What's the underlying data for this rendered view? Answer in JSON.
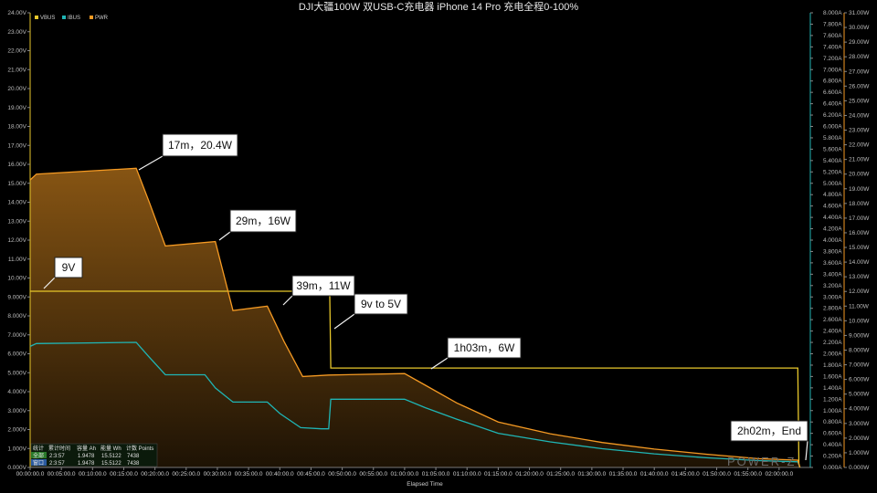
{
  "chart_data": {
    "type": "line",
    "title": "DJI大疆100W 双USB-C充电器 iPhone 14 Pro 充电全程0-100%",
    "xlabel": "Elapsed Time",
    "x_range_seconds": [
      0,
      7500
    ],
    "x_ticks": [
      "00:00:00.0",
      "00:05:00.0",
      "00:10:00.0",
      "00:15:00.0",
      "00:20:00.0",
      "00:25:00.0",
      "00:30:00.0",
      "00:35:00.0",
      "00:40:00.0",
      "00:45:00.0",
      "00:50:00.0",
      "00:55:00.0",
      "01:00:00.0",
      "01:05:00.0",
      "01:10:00.0",
      "01:15:00.0",
      "01:20:00.0",
      "01:25:00.0",
      "01:30:00.0",
      "01:35:00.0",
      "01:40:00.0",
      "01:45:00.0",
      "01:50:00.0",
      "01:55:00.0",
      "02:00:00.0"
    ],
    "y_left": {
      "range": [
        0,
        24
      ],
      "ticks": [
        "0.000V",
        "1.000V",
        "2.000V",
        "3.000V",
        "4.000V",
        "5.000V",
        "6.000V",
        "7.000V",
        "8.000V",
        "9.000V",
        "10.00V",
        "11.00V",
        "12.00V",
        "13.00V",
        "14.00V",
        "15.00V",
        "16.00V",
        "17.00V",
        "18.00V",
        "19.00V",
        "20.00V",
        "21.00V",
        "22.00V",
        "23.00V",
        "24.00V"
      ]
    },
    "y_right1": {
      "range": [
        0,
        8
      ],
      "ticks": [
        "0.000A",
        "0.200A",
        "0.400A",
        "0.600A",
        "0.800A",
        "1.000A",
        "1.200A",
        "1.400A",
        "1.600A",
        "1.800A",
        "2.000A",
        "2.200A",
        "2.400A",
        "2.600A",
        "2.800A",
        "3.000A",
        "3.200A",
        "3.400A",
        "3.600A",
        "3.800A",
        "4.000A",
        "4.200A",
        "4.400A",
        "4.600A",
        "4.800A",
        "5.000A",
        "5.200A",
        "5.400A",
        "5.600A",
        "5.800A",
        "6.000A",
        "6.200A",
        "6.400A",
        "6.600A",
        "6.800A",
        "7.000A",
        "7.200A",
        "7.400A",
        "7.600A",
        "7.800A",
        "8.000A"
      ]
    },
    "y_right2": {
      "range": [
        0,
        31
      ],
      "ticks": [
        "0.000W",
        "1.000W",
        "2.000W",
        "3.000W",
        "4.000W",
        "5.000W",
        "6.000W",
        "7.000W",
        "8.000W",
        "9.000W",
        "10.00W",
        "11.00W",
        "12.00W",
        "13.00W",
        "14.00W",
        "15.00W",
        "16.00W",
        "17.00W",
        "18.00W",
        "19.00W",
        "20.00W",
        "21.00W",
        "22.00W",
        "23.00W",
        "24.00W",
        "25.00W",
        "26.00W",
        "27.00W",
        "28.00W",
        "29.00W",
        "30.00W",
        "31.00W"
      ]
    },
    "series": [
      {
        "name": "VBUS",
        "color": "#e7c72b",
        "axis": "left",
        "x": [
          0,
          2880,
          2890,
          7380,
          7390,
          7400
        ],
        "y": [
          9.3,
          9.3,
          5.25,
          5.25,
          0.2,
          0.0
        ]
      },
      {
        "name": "IBUS",
        "color": "#1fb5b5",
        "axis": "right1",
        "x": [
          0,
          60,
          1020,
          1140,
          1300,
          1680,
          1780,
          1950,
          2280,
          2400,
          2600,
          2800,
          2870,
          2890,
          3000,
          3600,
          3800,
          4100,
          4500,
          5000,
          5500,
          6000,
          6500,
          7000,
          7380,
          7400
        ],
        "y": [
          2.13,
          2.18,
          2.2,
          1.95,
          1.63,
          1.63,
          1.4,
          1.15,
          1.15,
          0.95,
          0.7,
          0.68,
          0.68,
          1.2,
          1.2,
          1.2,
          1.05,
          0.85,
          0.6,
          0.45,
          0.33,
          0.24,
          0.17,
          0.12,
          0.1,
          0.0
        ]
      },
      {
        "name": "PWR",
        "color": "#f59a23",
        "axis": "right2",
        "x": [
          0,
          60,
          1020,
          1150,
          1300,
          1780,
          1950,
          2280,
          2440,
          2620,
          2870,
          3600,
          3800,
          4100,
          4500,
          5000,
          5500,
          6000,
          6500,
          7000,
          7380,
          7400
        ],
        "y": [
          19.6,
          20.0,
          20.4,
          18.0,
          15.1,
          15.4,
          10.7,
          11.0,
          8.6,
          6.2,
          6.3,
          6.4,
          5.6,
          4.4,
          3.1,
          2.3,
          1.7,
          1.25,
          0.9,
          0.6,
          0.5,
          0.0
        ]
      }
    ],
    "annotations": [
      {
        "text": "17m，20.4W"
      },
      {
        "text": "29m，16W"
      },
      {
        "text": "39m，11W"
      },
      {
        "text": "9V"
      },
      {
        "text": "9v to 5V"
      },
      {
        "text": "1h03m，6W"
      },
      {
        "text": "2h02m，End"
      }
    ],
    "legend": [
      "VBUS",
      "IBUS",
      "PWR"
    ],
    "legend_position": "top-left",
    "grid": false
  },
  "table": {
    "headers": [
      "统计",
      "累计时间",
      "容量 Ah",
      "能量 Wh",
      "计数 Points"
    ],
    "rows": [
      [
        "全部",
        "2:3:57",
        "1.9478",
        "15.5122",
        "7438"
      ],
      [
        "窗口",
        "2:3:57",
        "1.9478",
        "15.5122",
        "7438"
      ]
    ]
  },
  "watermark": "POWER-Z",
  "colors": {
    "vbus": "#e7c72b",
    "ibus": "#1fb5b5",
    "pwr": "#f59a23",
    "background": "#000000",
    "axis": "#7a7a7a"
  }
}
